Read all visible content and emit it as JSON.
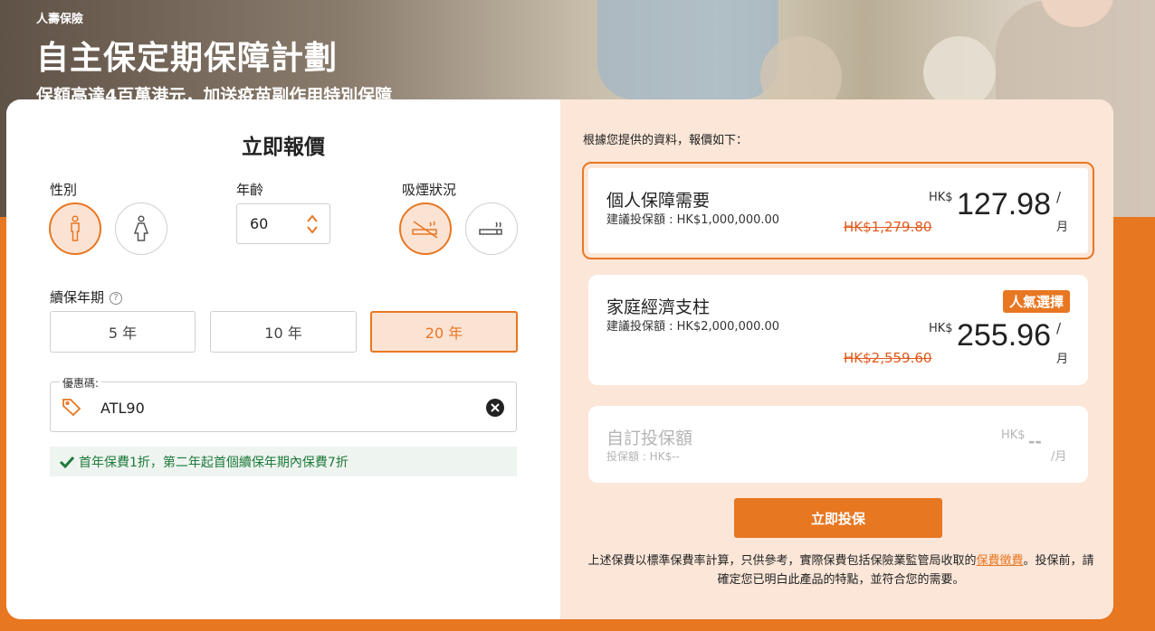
{
  "hero": {
    "tag": "人壽保險",
    "title": "自主保定期保障計劃",
    "subtitle": "保額高達4百萬港元，加送疫苗副作用特別保障"
  },
  "quote": {
    "title": "立即報價",
    "gender": {
      "label": "性別",
      "selected": "male",
      "options": [
        "male-icon",
        "female-icon"
      ]
    },
    "age": {
      "label": "年齡",
      "value": "60"
    },
    "smoking": {
      "label": "吸煙狀況",
      "selected": "non-smoker",
      "options": [
        "non-smoker-icon",
        "smoker-icon"
      ]
    },
    "term": {
      "label": "續保年期",
      "options": [
        "5 年",
        "10 年",
        "20 年"
      ],
      "selected": "20 年"
    },
    "promo": {
      "label": "優惠碼:",
      "value": "ATL90",
      "message": "首年保費1折，第二年起首個續保年期內保費7折"
    }
  },
  "result": {
    "intro": "根據您提供的資料，報價如下：",
    "plans": [
      {
        "name": "個人保障需要",
        "sum": "建議投保額 : HK$1,000,000.00",
        "currency": "HK$",
        "price": "127.98",
        "slash": "/",
        "per": "月",
        "original": "HK$1,279.80",
        "badge": "",
        "selected": true
      },
      {
        "name": "家庭經濟支柱",
        "sum": "建議投保額 : HK$2,000,000.00",
        "currency": "HK$",
        "price": "255.96",
        "slash": "/",
        "per": "月",
        "original": "HK$2,559.60",
        "badge": "人氣選擇",
        "selected": false
      },
      {
        "name": "自訂投保額",
        "sum": "投保額 : HK$--",
        "currency": "HK$",
        "price": "--",
        "per": "/月",
        "selected": false
      }
    ],
    "apply_label": "立即投保",
    "disclaimer_before": "上述保費以標準保費率計算，只供參考，實際保費包括保險業監管局收取的",
    "disclaimer_link": "保費徵費",
    "disclaimer_after": "。投保前，請確定您已明白此產品的特點，並符合您的需要。"
  },
  "colors": {
    "accent": "#e87722",
    "accent_light": "#fbe3d4",
    "panel": "#fbe6d8",
    "success": "#1e7a3a"
  }
}
